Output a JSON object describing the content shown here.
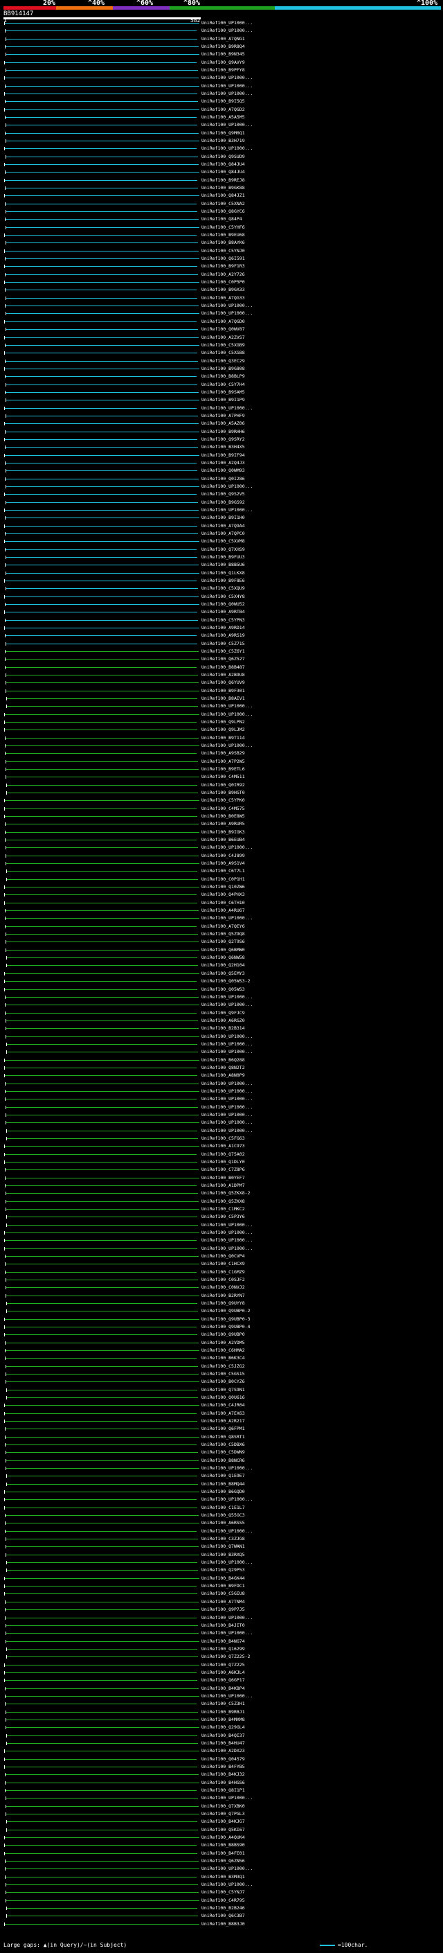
{
  "scale": {
    "labels": [
      "20%",
      "^40%",
      "^60%",
      "^80%",
      "^100%"
    ]
  },
  "query": {
    "id": "BB914147",
    "start": "1",
    "end": "582"
  },
  "colors": {
    "cyan": "#20c0e0",
    "green": "#22b022",
    "white": "#ffffff"
  },
  "hits": [
    {
      "label": "UniRef100_UP1000...",
      "c": "c"
    },
    {
      "label": "UniRef100_UP1000...",
      "c": "c"
    },
    {
      "label": "UniRef100_A7QNG1",
      "c": "c"
    },
    {
      "label": "UniRef100_B9R8Q4",
      "c": "c"
    },
    {
      "label": "UniRef100_B9N345",
      "c": "c"
    },
    {
      "label": "UniRef100_Q9AVY9",
      "c": "c"
    },
    {
      "label": "UniRef100_B9PFY8",
      "c": "c"
    },
    {
      "label": "UniRef100_UP1000...",
      "c": "c"
    },
    {
      "label": "UniRef100_UP1000...",
      "c": "c"
    },
    {
      "label": "UniRef100_UP1000...",
      "c": "c"
    },
    {
      "label": "UniRef100_B9I5Q5",
      "c": "c"
    },
    {
      "label": "UniRef100_A7QGD2",
      "c": "c"
    },
    {
      "label": "UniRef100_A5A5M5",
      "c": "c"
    },
    {
      "label": "UniRef100_UP1000...",
      "c": "c"
    },
    {
      "label": "UniRef100_Q9M0Q1",
      "c": "c"
    },
    {
      "label": "UniRef100_B3H719",
      "c": "c"
    },
    {
      "label": "UniRef100_UP1000...",
      "c": "c"
    },
    {
      "label": "UniRef100_Q9SUD9",
      "c": "c"
    },
    {
      "label": "UniRef100_Q84JU4",
      "c": "c"
    },
    {
      "label": "UniRef100_Q84JU4",
      "c": "c"
    },
    {
      "label": "UniRef100_B9REJ8",
      "c": "c"
    },
    {
      "label": "UniRef100_B9GK88",
      "c": "c"
    },
    {
      "label": "UniRef100_Q84JZ1",
      "c": "c"
    },
    {
      "label": "UniRef100_C5XNA2",
      "c": "c"
    },
    {
      "label": "UniRef100_Q8GYC6",
      "c": "c"
    },
    {
      "label": "UniRef100_Q84P4",
      "c": "c"
    },
    {
      "label": "UniRef100_C5YHF6",
      "c": "c"
    },
    {
      "label": "UniRef100_B9EU68",
      "c": "c"
    },
    {
      "label": "UniRef100_B8AYK6",
      "c": "c"
    },
    {
      "label": "UniRef100_C5YNJ0",
      "c": "c"
    },
    {
      "label": "UniRef100_Q6I591",
      "c": "c"
    },
    {
      "label": "UniRef100_B9F1R3",
      "c": "c"
    },
    {
      "label": "UniRef100_A2Y726",
      "c": "c"
    },
    {
      "label": "UniRef100_C0P5P0",
      "c": "c"
    },
    {
      "label": "UniRef100_B9GX33",
      "c": "c"
    },
    {
      "label": "UniRef100_A7QG33",
      "c": "c"
    },
    {
      "label": "UniRef100_UP1000...",
      "c": "c"
    },
    {
      "label": "UniRef100_UP1000...",
      "c": "c"
    },
    {
      "label": "UniRef100_A7QGD0",
      "c": "c"
    },
    {
      "label": "UniRef100_Q0WV87",
      "c": "c"
    },
    {
      "label": "UniRef100_A2ZVS7",
      "c": "c"
    },
    {
      "label": "UniRef100_C5XGB9",
      "c": "c"
    },
    {
      "label": "UniRef100_C5XG88",
      "c": "c"
    },
    {
      "label": "UniRef100_Q3EC29",
      "c": "c"
    },
    {
      "label": "UniRef100_B9G808",
      "c": "c"
    },
    {
      "label": "UniRef100_B8BLP9",
      "c": "c"
    },
    {
      "label": "UniRef100_C5Y7H4",
      "c": "c"
    },
    {
      "label": "UniRef100_B9SAM5",
      "c": "c"
    },
    {
      "label": "UniRef100_B9I1P9",
      "c": "c"
    },
    {
      "label": "UniRef100_UP1000...",
      "c": "c"
    },
    {
      "label": "UniRef100_A7PHF9",
      "c": "c"
    },
    {
      "label": "UniRef100_A5AZ06",
      "c": "c"
    },
    {
      "label": "UniRef100_B9RHH6",
      "c": "c"
    },
    {
      "label": "UniRef100_Q9SRY2",
      "c": "c"
    },
    {
      "label": "UniRef100_B3H4X5",
      "c": "c"
    },
    {
      "label": "UniRef100_B9IF94",
      "c": "c"
    },
    {
      "label": "UniRef100_A2Q4J3",
      "c": "c"
    },
    {
      "label": "UniRef100_Q0WM93",
      "c": "c"
    },
    {
      "label": "UniRef100_Q0I286",
      "c": "c"
    },
    {
      "label": "UniRef100_UP1000...",
      "c": "c"
    },
    {
      "label": "UniRef100_Q9S2V5",
      "c": "c"
    },
    {
      "label": "UniRef100_B9GS92",
      "c": "c"
    },
    {
      "label": "UniRef100_UP1000...",
      "c": "c"
    },
    {
      "label": "UniRef100_B9I1H0",
      "c": "c"
    },
    {
      "label": "UniRef100_A7Q9A4",
      "c": "c"
    },
    {
      "label": "UniRef100_A7QPC0",
      "c": "c"
    },
    {
      "label": "UniRef100_C5XVM8",
      "c": "c"
    },
    {
      "label": "UniRef100_Q7XHS9",
      "c": "c"
    },
    {
      "label": "UniRef100_B9FUU3",
      "c": "c"
    },
    {
      "label": "UniRef100_B8B5U6",
      "c": "c"
    },
    {
      "label": "UniRef100_Q1LKX8",
      "c": "c"
    },
    {
      "label": "UniRef100_B9F8E6",
      "c": "c"
    },
    {
      "label": "UniRef100_C5XQU9",
      "c": "c"
    },
    {
      "label": "UniRef100_C5X4Y8",
      "c": "c"
    },
    {
      "label": "UniRef100_Q0WU52",
      "c": "c"
    },
    {
      "label": "UniRef100_A9RTB4",
      "c": "c"
    },
    {
      "label": "UniRef100_C5YPN3",
      "c": "c"
    },
    {
      "label": "UniRef100_A9RD14",
      "c": "c"
    },
    {
      "label": "UniRef100_A9RS19",
      "c": "c"
    },
    {
      "label": "UniRef100_C5Z715",
      "c": "c"
    },
    {
      "label": "UniRef100_C5Z6Y1",
      "c": "g"
    },
    {
      "label": "UniRef100_Q6Z527",
      "c": "g"
    },
    {
      "label": "UniRef100_B8B487",
      "c": "g"
    },
    {
      "label": "UniRef100_A2B9U8",
      "c": "g"
    },
    {
      "label": "UniRef100_Q6YUV9",
      "c": "g"
    },
    {
      "label": "UniRef100_B9F301",
      "c": "g"
    },
    {
      "label": "UniRef100_B8AIV1",
      "c": "g"
    },
    {
      "label": "UniRef100_UP1000...",
      "c": "g"
    },
    {
      "label": "UniRef100_UP1000...",
      "c": "g"
    },
    {
      "label": "UniRef100_Q9LPN2",
      "c": "g"
    },
    {
      "label": "UniRef100_Q9LJM2",
      "c": "g"
    },
    {
      "label": "UniRef100_B9T114",
      "c": "g"
    },
    {
      "label": "UniRef100_UP1000...",
      "c": "g"
    },
    {
      "label": "UniRef100_A9SB29",
      "c": "g"
    },
    {
      "label": "UniRef100_A7P2W5",
      "c": "g"
    },
    {
      "label": "UniRef100_B9ETL6",
      "c": "g"
    },
    {
      "label": "UniRef100_C4M511",
      "c": "g"
    },
    {
      "label": "UniRef100_Q0IR92",
      "c": "g"
    },
    {
      "label": "UniRef100_B9HGT0",
      "c": "g"
    },
    {
      "label": "UniRef100_C5YPK0",
      "c": "g"
    },
    {
      "label": "UniRef100_C4M575",
      "c": "g"
    },
    {
      "label": "UniRef100_B0E8W5",
      "c": "g"
    },
    {
      "label": "UniRef100_A9RUR5",
      "c": "g"
    },
    {
      "label": "UniRef100_B9IGK3",
      "c": "g"
    },
    {
      "label": "UniRef100_B6EUB4",
      "c": "g"
    },
    {
      "label": "UniRef100_UP1000...",
      "c": "g"
    },
    {
      "label": "UniRef100_C4J899",
      "c": "g"
    },
    {
      "label": "UniRef100_A9S1V4",
      "c": "g"
    },
    {
      "label": "UniRef100_C6T7L1",
      "c": "g"
    },
    {
      "label": "UniRef100_C0P1H1",
      "c": "g"
    },
    {
      "label": "UniRef100_Q10ZW6",
      "c": "g"
    },
    {
      "label": "UniRef100_Q4PHX3",
      "c": "g"
    },
    {
      "label": "UniRef100_C6TH10",
      "c": "g"
    },
    {
      "label": "UniRef100_A4RU67",
      "c": "g"
    },
    {
      "label": "UniRef100_UP1000...",
      "c": "g"
    },
    {
      "label": "UniRef100_A7QEY6",
      "c": "g"
    },
    {
      "label": "UniRef100_Q5Z9Q8",
      "c": "g"
    },
    {
      "label": "UniRef100_Q2T9S6",
      "c": "g"
    },
    {
      "label": "UniRef100_Q6BMW0",
      "c": "g"
    },
    {
      "label": "UniRef100_Q6NW58",
      "c": "g"
    },
    {
      "label": "UniRef100_Q2H104",
      "c": "g"
    },
    {
      "label": "UniRef100_Q5EMY3",
      "c": "g"
    },
    {
      "label": "UniRef100_Q05WS3-2",
      "c": "g"
    },
    {
      "label": "UniRef100_Q05WS3",
      "c": "g"
    },
    {
      "label": "UniRef100_UP1000...",
      "c": "g"
    },
    {
      "label": "UniRef100_UP1000...",
      "c": "g"
    },
    {
      "label": "UniRef100_Q9FJC9",
      "c": "g"
    },
    {
      "label": "UniRef100_A6RGZ0",
      "c": "g"
    },
    {
      "label": "UniRef100_B2B314",
      "c": "g"
    },
    {
      "label": "UniRef100_UP1000...",
      "c": "g"
    },
    {
      "label": "UniRef100_UP1000...",
      "c": "g"
    },
    {
      "label": "UniRef100_UP1000...",
      "c": "g"
    },
    {
      "label": "UniRef100_B6Q288",
      "c": "g"
    },
    {
      "label": "UniRef100_Q8N2T2",
      "c": "g"
    },
    {
      "label": "UniRef100_A8N0P9",
      "c": "g"
    },
    {
      "label": "UniRef100_UP1000...",
      "c": "g"
    },
    {
      "label": "UniRef100_UP1000...",
      "c": "g"
    },
    {
      "label": "UniRef100_UP1000...",
      "c": "g"
    },
    {
      "label": "UniRef100_UP1000...",
      "c": "g"
    },
    {
      "label": "UniRef100_UP1000...",
      "c": "g"
    },
    {
      "label": "UniRef100_UP1000...",
      "c": "g"
    },
    {
      "label": "UniRef100_UP1000...",
      "c": "g"
    },
    {
      "label": "UniRef100_C5FG63",
      "c": "g"
    },
    {
      "label": "UniRef100_A1C973",
      "c": "g"
    },
    {
      "label": "UniRef100_Q75A02",
      "c": "g"
    },
    {
      "label": "UniRef100_Q1DLY0",
      "c": "g"
    },
    {
      "label": "UniRef100_C7Z8P6",
      "c": "g"
    },
    {
      "label": "UniRef100_B0YEF7",
      "c": "g"
    },
    {
      "label": "UniRef100_A1DPM7",
      "c": "g"
    },
    {
      "label": "UniRef100_Q5ZKX8-2",
      "c": "g"
    },
    {
      "label": "UniRef100_Q5ZKX8",
      "c": "g"
    },
    {
      "label": "UniRef100_C1MKC2",
      "c": "g"
    },
    {
      "label": "UniRef100_C5P3Y6",
      "c": "g"
    },
    {
      "label": "UniRef100_UP1000...",
      "c": "g"
    },
    {
      "label": "UniRef100_UP1000...",
      "c": "g"
    },
    {
      "label": "UniRef100_UP1000...",
      "c": "g"
    },
    {
      "label": "UniRef100_UP1000...",
      "c": "g"
    },
    {
      "label": "UniRef100_Q0CVP4",
      "c": "g"
    },
    {
      "label": "UniRef100_C1HCX9",
      "c": "g"
    },
    {
      "label": "UniRef100_C1GMZ9",
      "c": "g"
    },
    {
      "label": "UniRef100_C0SJF2",
      "c": "g"
    },
    {
      "label": "UniRef100_C0NVJ2",
      "c": "g"
    },
    {
      "label": "UniRef100_B2RYN7",
      "c": "g"
    },
    {
      "label": "UniRef100_Q9UYY8",
      "c": "g"
    },
    {
      "label": "UniRef100_Q9UBP0-2",
      "c": "g"
    },
    {
      "label": "UniRef100_Q9UBP0-3",
      "c": "g"
    },
    {
      "label": "UniRef100_Q9UBP0-4",
      "c": "g"
    },
    {
      "label": "UniRef100_Q9UBP0",
      "c": "g"
    },
    {
      "label": "UniRef100_A2VDM5",
      "c": "g"
    },
    {
      "label": "UniRef100_C6HMA2",
      "c": "g"
    },
    {
      "label": "UniRef100_B6K3C4",
      "c": "g"
    },
    {
      "label": "UniRef100_C5JZG2",
      "c": "g"
    },
    {
      "label": "UniRef100_C5GS15",
      "c": "g"
    },
    {
      "label": "UniRef100_B0CYZ6",
      "c": "g"
    },
    {
      "label": "UniRef100_Q7S9N1",
      "c": "g"
    },
    {
      "label": "UniRef100_Q0U616",
      "c": "g"
    },
    {
      "label": "UniRef100_C4JR04",
      "c": "g"
    },
    {
      "label": "UniRef100_A7EX63",
      "c": "g"
    },
    {
      "label": "UniRef100_A2R217",
      "c": "g"
    },
    {
      "label": "UniRef100_Q6FPM1",
      "c": "g"
    },
    {
      "label": "UniRef100_Q8SRT1",
      "c": "g"
    },
    {
      "label": "UniRef100_C5DBX6",
      "c": "g"
    },
    {
      "label": "UniRef100_C5DWN9",
      "c": "g"
    },
    {
      "label": "UniRef100_B8NCR6",
      "c": "g"
    },
    {
      "label": "UniRef100_UP1000...",
      "c": "g"
    },
    {
      "label": "UniRef100_Q1E9E7",
      "c": "g"
    },
    {
      "label": "UniRef100_B8MQ44",
      "c": "g"
    },
    {
      "label": "UniRef100_B6GQD0",
      "c": "g"
    },
    {
      "label": "UniRef100_UP1000...",
      "c": "g"
    },
    {
      "label": "UniRef100_C1E1L7",
      "c": "g"
    },
    {
      "label": "UniRef100_Q55GC3",
      "c": "g"
    },
    {
      "label": "UniRef100_A6RSS5",
      "c": "g"
    },
    {
      "label": "UniRef100_UP1000...",
      "c": "g"
    },
    {
      "label": "UniRef100_C3ZJG8",
      "c": "g"
    },
    {
      "label": "UniRef100_Q7WAN1",
      "c": "g"
    },
    {
      "label": "UniRef100_B3RXQ5",
      "c": "g"
    },
    {
      "label": "UniRef100_UP1000...",
      "c": "g"
    },
    {
      "label": "UniRef100_Q29P53",
      "c": "g"
    },
    {
      "label": "UniRef100_B4GK44",
      "c": "g"
    },
    {
      "label": "UniRef100_B9FDC1",
      "c": "g"
    },
    {
      "label": "UniRef100_C5GIU8",
      "c": "g"
    },
    {
      "label": "UniRef100_A7TNM4",
      "c": "g"
    },
    {
      "label": "UniRef100_Q9P7J5",
      "c": "g"
    },
    {
      "label": "UniRef100_UP1000...",
      "c": "g"
    },
    {
      "label": "UniRef100_B4JIT0",
      "c": "g"
    },
    {
      "label": "UniRef100_UP1000...",
      "c": "g"
    },
    {
      "label": "UniRef100_B4NG74",
      "c": "g"
    },
    {
      "label": "UniRef100_Q16299",
      "c": "g"
    },
    {
      "label": "UniRef100_Q7Z225-2",
      "c": "g"
    },
    {
      "label": "UniRef100_Q7Z225",
      "c": "g"
    },
    {
      "label": "UniRef100_A6KJL4",
      "c": "g"
    },
    {
      "label": "UniRef100_Q6GP17",
      "c": "g"
    },
    {
      "label": "UniRef100_B4KBP4",
      "c": "g"
    },
    {
      "label": "UniRef100_UP1000...",
      "c": "g"
    },
    {
      "label": "UniRef100_C5Z3H1",
      "c": "g"
    },
    {
      "label": "UniRef100_B9RBJ1",
      "c": "g"
    },
    {
      "label": "UniRef100_B4MXM8",
      "c": "g"
    },
    {
      "label": "UniRef100_Q29GL4",
      "c": "g"
    },
    {
      "label": "UniRef100_B4QI37",
      "c": "g"
    },
    {
      "label": "UniRef100_B4HU47",
      "c": "g"
    },
    {
      "label": "UniRef100_A2DX23",
      "c": "g"
    },
    {
      "label": "UniRef100_Q04579",
      "c": "g"
    },
    {
      "label": "UniRef100_B4FYB5",
      "c": "g"
    },
    {
      "label": "UniRef100_B4KJ32",
      "c": "g"
    },
    {
      "label": "UniRef100_B4HGS6",
      "c": "g"
    },
    {
      "label": "UniRef100_Q8I1P1",
      "c": "g"
    },
    {
      "label": "UniRef100_UP1000...",
      "c": "g"
    },
    {
      "label": "UniRef100_Q7XBK0",
      "c": "g"
    },
    {
      "label": "UniRef100_Q7PGL3",
      "c": "g"
    },
    {
      "label": "UniRef100_B4KJG7",
      "c": "g"
    },
    {
      "label": "UniRef100_Q5KI67",
      "c": "g"
    },
    {
      "label": "UniRef100_A4QUK4",
      "c": "g"
    },
    {
      "label": "UniRef100_B8BS90",
      "c": "g"
    },
    {
      "label": "UniRef100_B4FE01",
      "c": "g"
    },
    {
      "label": "UniRef100_Q6ZN56",
      "c": "g"
    },
    {
      "label": "UniRef100_UP1000...",
      "c": "g"
    },
    {
      "label": "UniRef100_B3M3Q1",
      "c": "g"
    },
    {
      "label": "UniRef100_UP1000...",
      "c": "g"
    },
    {
      "label": "UniRef100_C5YNJ7",
      "c": "g"
    },
    {
      "label": "UniRef100_C4R795",
      "c": "g"
    },
    {
      "label": "UniRef100_B2B246",
      "c": "g"
    },
    {
      "label": "UniRef100_Q6C3B7",
      "c": "g"
    },
    {
      "label": "UniRef100_B8B3J0",
      "c": "g"
    }
  ],
  "legend": {
    "left": "Large gaps: ▲(in Query)/~(in Subject)",
    "right": "=100char."
  }
}
